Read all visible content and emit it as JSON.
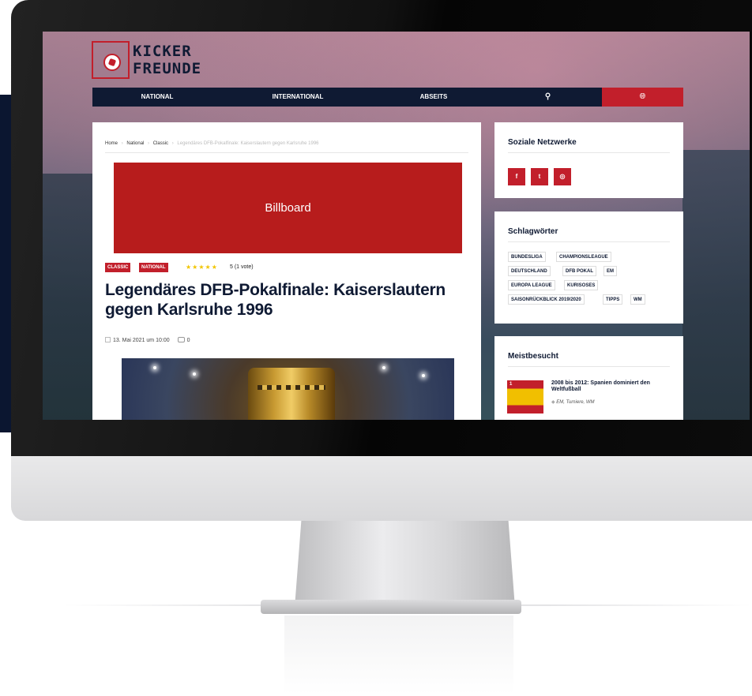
{
  "site": {
    "logo_line1": "KICKER",
    "logo_line2": "FREUNDE"
  },
  "nav": {
    "items": [
      "NATIONAL",
      "INTERNATIONAL",
      "ABSEITS"
    ],
    "search_icon": "search-icon",
    "globe_icon": "globe-icon"
  },
  "breadcrumb": {
    "home": "Home",
    "sep": "›",
    "national": "National",
    "classic": "Classic",
    "current": "Legendäres DFB-Pokalfinale: Kaiserslautern gegen Karlsruhe 1996"
  },
  "ad": {
    "label": "Billboard"
  },
  "article": {
    "tags": [
      "CLASSIC",
      "NATIONAL"
    ],
    "rating_stars": "★★★★★",
    "rating_text": "5 (1 vote)",
    "title": "Legendäres DFB-Pokalfinale: Kaiserslautern gegen Karlsruhe 1996",
    "date": "13. Mai 2021 um 10:00",
    "comments": "0"
  },
  "sidebar": {
    "social": {
      "title": "Soziale Netzwerke",
      "buttons": [
        "f",
        "t",
        "◎"
      ]
    },
    "tags": {
      "title": "Schlagwörter",
      "items": [
        "BUNDESLIGA",
        "CHAMPIONSLEAGUE",
        "DEUTSCHLAND",
        "DFB POKAL",
        "EM",
        "EUROPA LEAGUE",
        "KURISOSES",
        "SAISONRÜCKBLICK 2019/2020",
        "TIPPS",
        "WM"
      ]
    },
    "popular": {
      "title": "Meistbesucht",
      "post_rank": "1",
      "post_title": "2008 bis 2012: Spanien dominiert den Weltfußball",
      "post_tags": "EM, Turniere, WM"
    }
  },
  "colors": {
    "brand_red": "#c21f2b",
    "navy": "#0f1a33"
  }
}
